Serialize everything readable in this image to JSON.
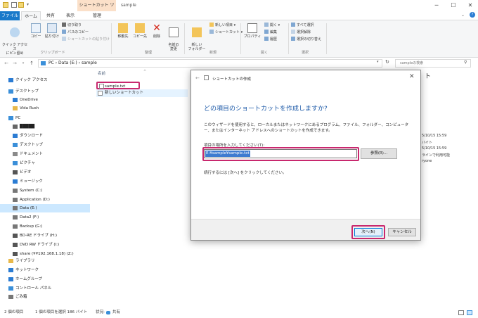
{
  "titlebar": {
    "tool_tab": "ショートカット ツール",
    "title": "sample",
    "minimize": "─",
    "maximize": "☐",
    "close": "✕"
  },
  "tabs": [
    "ファイル",
    "ホーム",
    "共有",
    "表示",
    "管理"
  ],
  "ribbon": {
    "clipboard": {
      "quick_access": "クイック アクセス\nにピン留め",
      "copy": "コピー",
      "paste": "貼り付け",
      "cut": "切り取り",
      "copy_path": "パスのコピー",
      "paste_shortcut": "ショートカットの貼り付け",
      "label": "クリップボード"
    },
    "organize": {
      "move_to": "移動先",
      "copy_to": "コピー先",
      "delete": "削除",
      "rename": "名前の\n変更",
      "label": "整理"
    },
    "new": {
      "new_folder": "新しい\nフォルダー",
      "new_item": "新しい項目",
      "shortcut": "ショートカット",
      "label": "新規"
    },
    "open": {
      "properties": "プロパティ",
      "open": "開く",
      "edit": "編集",
      "history": "履歴",
      "label": "開く"
    },
    "select": {
      "select_all": "すべて選択",
      "select_none": "選択解除",
      "invert": "選択の切り替え",
      "label": "選択"
    }
  },
  "address": {
    "path": "PC  ›  Data (E:)  ›  sample",
    "search_placeholder": "sampleの検索"
  },
  "nav": [
    {
      "label": "クイック アクセス",
      "icon": "star-icon",
      "color": "#2b7cd3"
    },
    {
      "label": "デスクトップ",
      "icon": "desktop-icon",
      "color": "#3a8fd9"
    },
    {
      "label": "OneDrive",
      "icon": "cloud-icon",
      "color": "#2b7cd3"
    },
    {
      "label": "Vida Rush",
      "icon": "user-icon",
      "color": "#e8b84a"
    },
    {
      "label": "PC",
      "icon": "pc-icon",
      "color": "#3a8fd9"
    },
    {
      "label": "█████",
      "icon": "pc-icon",
      "color": "#666666"
    },
    {
      "label": "ダウンロード",
      "icon": "download-icon",
      "color": "#2b7cd3"
    },
    {
      "label": "デスクトップ",
      "icon": "desktop-icon",
      "color": "#3a8fd9"
    },
    {
      "label": "ドキュメント",
      "icon": "document-icon",
      "color": "#8a8a8a"
    },
    {
      "label": "ピクチャ",
      "icon": "picture-icon",
      "color": "#3a8fd9"
    },
    {
      "label": "ビデオ",
      "icon": "video-icon",
      "color": "#555555"
    },
    {
      "label": "ミュージック",
      "icon": "music-icon",
      "color": "#2b7cd3"
    },
    {
      "label": "System (C:)",
      "icon": "drive-icon",
      "color": "#777777"
    },
    {
      "label": "Application (D:)",
      "icon": "drive-icon",
      "color": "#777777"
    },
    {
      "label": "Data (E:)",
      "icon": "drive-icon",
      "color": "#777777"
    },
    {
      "label": "Data2 (F:)",
      "icon": "drive-icon",
      "color": "#777777"
    },
    {
      "label": "Backup (G:)",
      "icon": "drive-icon",
      "color": "#777777"
    },
    {
      "label": "BD-RE ドライブ (H:)",
      "icon": "disc-drive-icon",
      "color": "#555555"
    },
    {
      "label": "DVD RW ドライブ (I:)",
      "icon": "disc-drive-icon",
      "color": "#555555"
    },
    {
      "label": "share (¥¥192.168.1.18) (Z:)",
      "icon": "network-drive-icon",
      "color": "#555555"
    },
    {
      "label": "ライブラリ",
      "icon": "library-icon",
      "color": "#e8b84a"
    },
    {
      "label": "ネットワーク",
      "icon": "network-icon",
      "color": "#2b7cd3"
    },
    {
      "label": "ホームグループ",
      "icon": "homegroup-icon",
      "color": "#2b7cd3"
    },
    {
      "label": "コントロール パネル",
      "icon": "control-panel-icon",
      "color": "#3a8fd9"
    },
    {
      "label": "ごみ箱",
      "icon": "recycle-bin-icon",
      "color": "#777777"
    }
  ],
  "filelist": {
    "col_name": "名前",
    "files": [
      "sample.txt",
      "新しいショートカット"
    ]
  },
  "details": [
    "5/10/15 15:59",
    "バイト",
    "5/10/15 15:59",
    "ラインで利用可能",
    "ryone"
  ],
  "status": {
    "items": "2 個の項目",
    "selected": "1 個の項目を選択  186 バイト",
    "state": "状況:",
    "shared": "共有"
  },
  "dialog": {
    "title": "ショートカットの作成",
    "heading": "どの項目のショートカットを作成しますか?",
    "description": "このウィザードを使用すると、ローカルまたはネットワークにあるプログラム、ファイル、フォルダー、コンピューター、またはインターネット アドレスへのショートカットを作成できます。",
    "label": "項目の場所を入力してください(T):",
    "location_value": "E:¥sample¥sample.txt",
    "browse": "参照(R)...",
    "continue_text": "続行するには [次へ] をクリックしてください。",
    "next": "次へ(N)",
    "cancel": "キャンセル"
  }
}
